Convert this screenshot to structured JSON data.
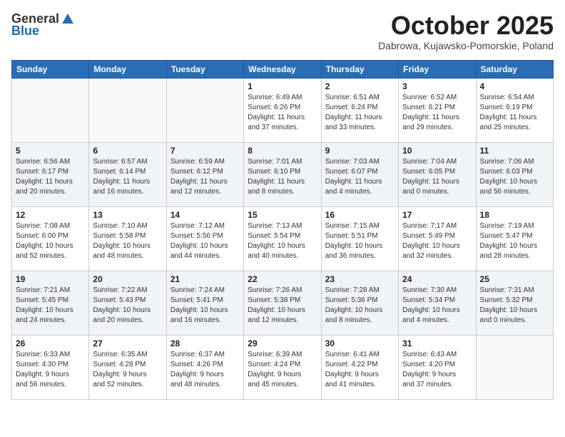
{
  "header": {
    "logo_general": "General",
    "logo_blue": "Blue",
    "month_title": "October 2025",
    "location": "Dabrowa, Kujawsko-Pomorskie, Poland"
  },
  "days_of_week": [
    "Sunday",
    "Monday",
    "Tuesday",
    "Wednesday",
    "Thursday",
    "Friday",
    "Saturday"
  ],
  "weeks": [
    [
      {
        "day": "",
        "info": ""
      },
      {
        "day": "",
        "info": ""
      },
      {
        "day": "",
        "info": ""
      },
      {
        "day": "1",
        "info": "Sunrise: 6:49 AM\nSunset: 6:26 PM\nDaylight: 11 hours\nand 37 minutes."
      },
      {
        "day": "2",
        "info": "Sunrise: 6:51 AM\nSunset: 6:24 PM\nDaylight: 11 hours\nand 33 minutes."
      },
      {
        "day": "3",
        "info": "Sunrise: 6:52 AM\nSunset: 6:21 PM\nDaylight: 11 hours\nand 29 minutes."
      },
      {
        "day": "4",
        "info": "Sunrise: 6:54 AM\nSunset: 6:19 PM\nDaylight: 11 hours\nand 25 minutes."
      }
    ],
    [
      {
        "day": "5",
        "info": "Sunrise: 6:56 AM\nSunset: 6:17 PM\nDaylight: 11 hours\nand 20 minutes."
      },
      {
        "day": "6",
        "info": "Sunrise: 6:57 AM\nSunset: 6:14 PM\nDaylight: 11 hours\nand 16 minutes."
      },
      {
        "day": "7",
        "info": "Sunrise: 6:59 AM\nSunset: 6:12 PM\nDaylight: 11 hours\nand 12 minutes."
      },
      {
        "day": "8",
        "info": "Sunrise: 7:01 AM\nSunset: 6:10 PM\nDaylight: 11 hours\nand 8 minutes."
      },
      {
        "day": "9",
        "info": "Sunrise: 7:03 AM\nSunset: 6:07 PM\nDaylight: 11 hours\nand 4 minutes."
      },
      {
        "day": "10",
        "info": "Sunrise: 7:04 AM\nSunset: 6:05 PM\nDaylight: 11 hours\nand 0 minutes."
      },
      {
        "day": "11",
        "info": "Sunrise: 7:06 AM\nSunset: 6:03 PM\nDaylight: 10 hours\nand 56 minutes."
      }
    ],
    [
      {
        "day": "12",
        "info": "Sunrise: 7:08 AM\nSunset: 6:00 PM\nDaylight: 10 hours\nand 52 minutes."
      },
      {
        "day": "13",
        "info": "Sunrise: 7:10 AM\nSunset: 5:58 PM\nDaylight: 10 hours\nand 48 minutes."
      },
      {
        "day": "14",
        "info": "Sunrise: 7:12 AM\nSunset: 5:56 PM\nDaylight: 10 hours\nand 44 minutes."
      },
      {
        "day": "15",
        "info": "Sunrise: 7:13 AM\nSunset: 5:54 PM\nDaylight: 10 hours\nand 40 minutes."
      },
      {
        "day": "16",
        "info": "Sunrise: 7:15 AM\nSunset: 5:51 PM\nDaylight: 10 hours\nand 36 minutes."
      },
      {
        "day": "17",
        "info": "Sunrise: 7:17 AM\nSunset: 5:49 PM\nDaylight: 10 hours\nand 32 minutes."
      },
      {
        "day": "18",
        "info": "Sunrise: 7:19 AM\nSunset: 5:47 PM\nDaylight: 10 hours\nand 28 minutes."
      }
    ],
    [
      {
        "day": "19",
        "info": "Sunrise: 7:21 AM\nSunset: 5:45 PM\nDaylight: 10 hours\nand 24 minutes."
      },
      {
        "day": "20",
        "info": "Sunrise: 7:22 AM\nSunset: 5:43 PM\nDaylight: 10 hours\nand 20 minutes."
      },
      {
        "day": "21",
        "info": "Sunrise: 7:24 AM\nSunset: 5:41 PM\nDaylight: 10 hours\nand 16 minutes."
      },
      {
        "day": "22",
        "info": "Sunrise: 7:26 AM\nSunset: 5:38 PM\nDaylight: 10 hours\nand 12 minutes."
      },
      {
        "day": "23",
        "info": "Sunrise: 7:28 AM\nSunset: 5:36 PM\nDaylight: 10 hours\nand 8 minutes."
      },
      {
        "day": "24",
        "info": "Sunrise: 7:30 AM\nSunset: 5:34 PM\nDaylight: 10 hours\nand 4 minutes."
      },
      {
        "day": "25",
        "info": "Sunrise: 7:31 AM\nSunset: 5:32 PM\nDaylight: 10 hours\nand 0 minutes."
      }
    ],
    [
      {
        "day": "26",
        "info": "Sunrise: 6:33 AM\nSunset: 4:30 PM\nDaylight: 9 hours\nand 56 minutes."
      },
      {
        "day": "27",
        "info": "Sunrise: 6:35 AM\nSunset: 4:28 PM\nDaylight: 9 hours\nand 52 minutes."
      },
      {
        "day": "28",
        "info": "Sunrise: 6:37 AM\nSunset: 4:26 PM\nDaylight: 9 hours\nand 48 minutes."
      },
      {
        "day": "29",
        "info": "Sunrise: 6:39 AM\nSunset: 4:24 PM\nDaylight: 9 hours\nand 45 minutes."
      },
      {
        "day": "30",
        "info": "Sunrise: 6:41 AM\nSunset: 4:22 PM\nDaylight: 9 hours\nand 41 minutes."
      },
      {
        "day": "31",
        "info": "Sunrise: 6:43 AM\nSunset: 4:20 PM\nDaylight: 9 hours\nand 37 minutes."
      },
      {
        "day": "",
        "info": ""
      }
    ]
  ],
  "shaded_rows": [
    1,
    3
  ]
}
